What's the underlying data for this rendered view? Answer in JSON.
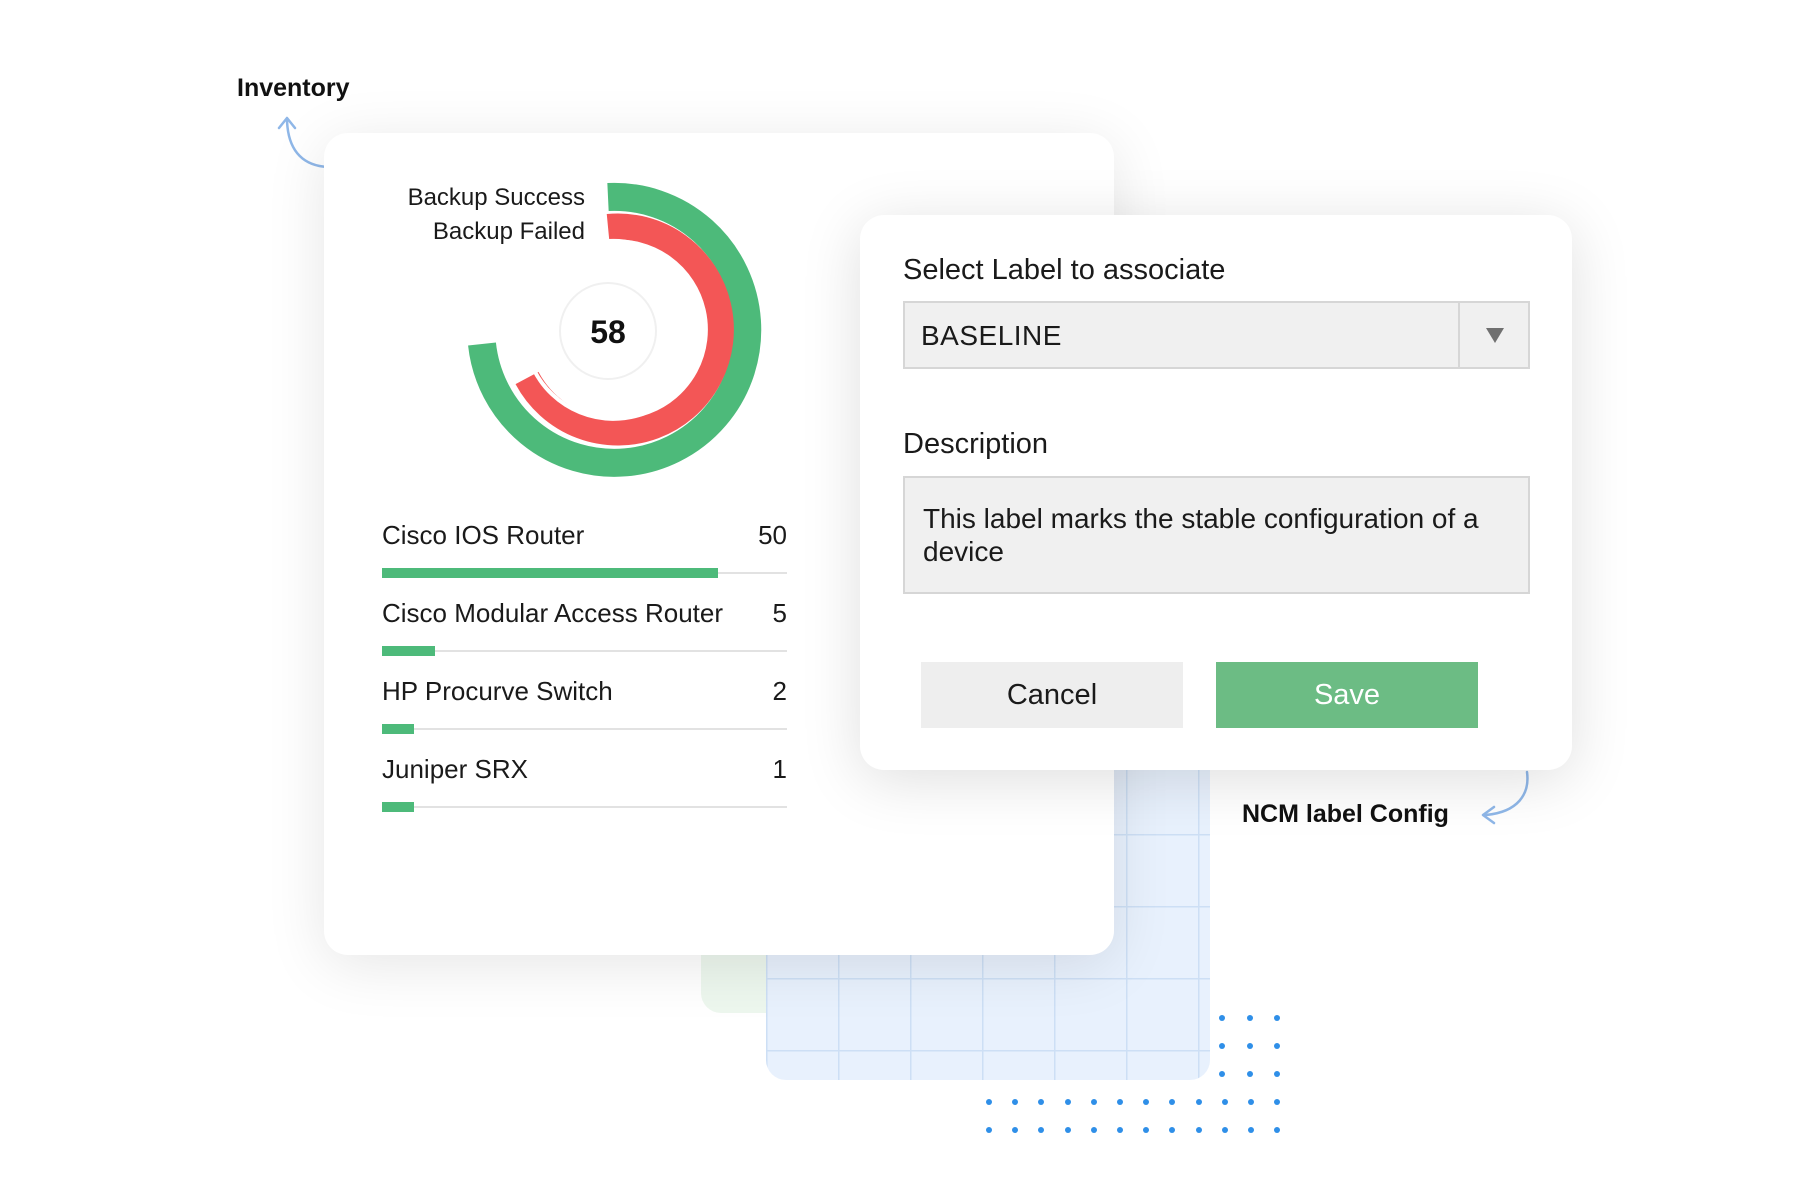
{
  "annotations": {
    "inventory": "Inventory",
    "ncm": "NCM label Config"
  },
  "inventory_card": {
    "legend": {
      "success": "Backup Success",
      "failed": "Backup Failed"
    },
    "total": "58",
    "colors": {
      "success": "#4dba7a",
      "failed": "#f35656"
    },
    "devices": [
      {
        "name": "Cisco IOS Router",
        "count": "50",
        "fill_fraction": 0.83
      },
      {
        "name": "Cisco Modular Access Router",
        "count": "5",
        "fill_fraction": 0.13
      },
      {
        "name": "HP Procurve  Switch",
        "count": "2",
        "fill_fraction": 0.08
      },
      {
        "name": "Juniper SRX",
        "count": "1",
        "fill_fraction": 0.08
      }
    ]
  },
  "label_dialog": {
    "select_label": "Select Label to associate",
    "selected_value": "BASELINE",
    "description_label": "Description",
    "description_value": "This label marks the stable configuration of a device",
    "cancel_label": "Cancel",
    "save_label": "Save",
    "save_color": "#6cbc84"
  }
}
